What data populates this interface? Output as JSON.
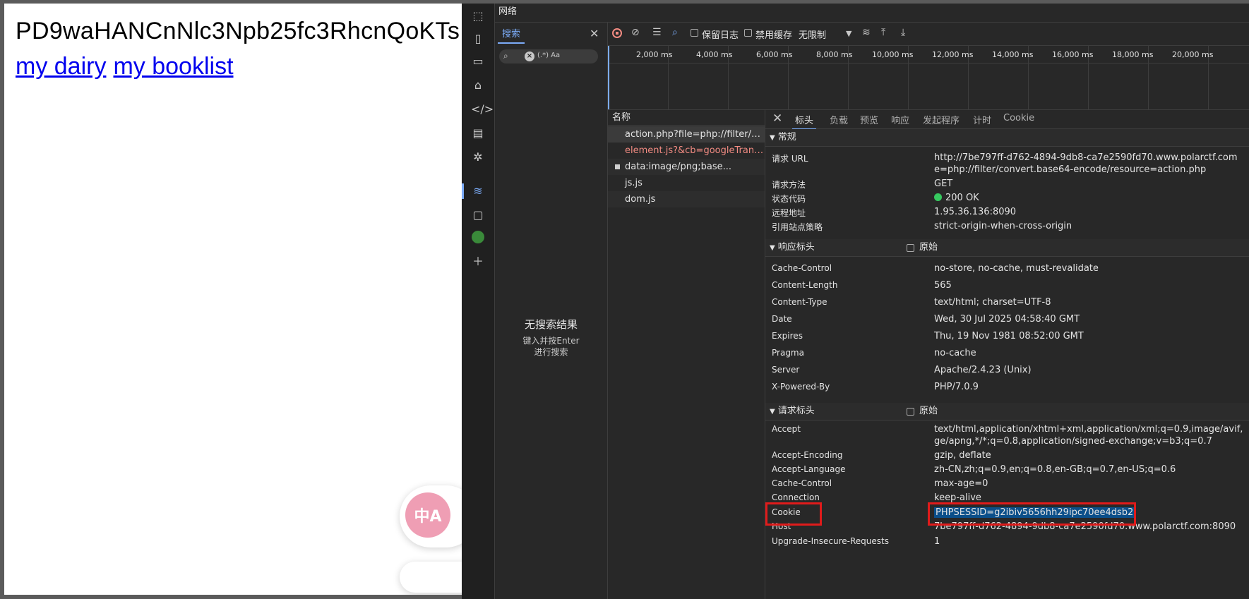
{
  "page": {
    "base64_text": "PD9waHANCnNlc3Npb25fc3RhcnQoKTs",
    "links": [
      "my dairy",
      "my booklist"
    ],
    "translate_glyph": "中A"
  },
  "devtools": {
    "panel_title": "网络",
    "search": {
      "tab_label": "搜索",
      "options_label": "(.*) Aa",
      "no_result_title": "无搜索结果",
      "no_result_hint_1": "键入并按Enter",
      "no_result_hint_2": "进行搜索"
    },
    "toolbar": {
      "preserve_log": "保留日志",
      "disable_cache": "禁用缓存",
      "throttling": "无限制"
    },
    "timeline_ticks": [
      "2,000 ms",
      "4,000 ms",
      "6,000 ms",
      "8,000 ms",
      "10,000 ms",
      "12,000 ms",
      "14,000 ms",
      "16,000 ms",
      "18,000 ms",
      "20,000 ms"
    ],
    "requests": {
      "header": "名称",
      "rows": [
        {
          "name": "action.php?file=php://filter/con..."
        },
        {
          "name": "element.js?&cb=googleTranslat..."
        },
        {
          "name": "data:image/png;base..."
        },
        {
          "name": "js.js"
        },
        {
          "name": "dom.js"
        }
      ]
    },
    "detail_tabs": [
      "标头",
      "负载",
      "预览",
      "响应",
      "发起程序",
      "计时",
      "Cookie"
    ],
    "general": {
      "title": "常规",
      "request_url_label": "请求 URL",
      "request_url_line1": "http://7be797ff-d762-4894-9db8-ca7e2590fd70.www.polarctf.com",
      "request_url_line2": "e=php://filter/convert.base64-encode/resource=action.php",
      "method_label": "请求方法",
      "method": "GET",
      "status_label": "状态代码",
      "status": "200 OK",
      "remote_label": "远程地址",
      "remote": "1.95.36.136:8090",
      "referrer_label": "引用站点策略",
      "referrer": "strict-origin-when-cross-origin"
    },
    "response_headers": {
      "title": "响应标头",
      "raw_label": "原始",
      "items": [
        {
          "k": "Cache-Control",
          "v": "no-store, no-cache, must-revalidate"
        },
        {
          "k": "Content-Length",
          "v": "565"
        },
        {
          "k": "Content-Type",
          "v": "text/html; charset=UTF-8"
        },
        {
          "k": "Date",
          "v": "Wed, 30 Jul 2025 04:58:40 GMT"
        },
        {
          "k": "Expires",
          "v": "Thu, 19 Nov 1981 08:52:00 GMT"
        },
        {
          "k": "Pragma",
          "v": "no-cache"
        },
        {
          "k": "Server",
          "v": "Apache/2.4.23 (Unix)"
        },
        {
          "k": "X-Powered-By",
          "v": "PHP/7.0.9"
        }
      ]
    },
    "request_headers": {
      "title": "请求标头",
      "raw_label": "原始",
      "accept_label": "Accept",
      "accept_line1": "text/html,application/xhtml+xml,application/xml;q=0.9,image/avif,",
      "accept_line2": "ge/apng,*/*;q=0.8,application/signed-exchange;v=b3;q=0.7",
      "encoding_label": "Accept-Encoding",
      "encoding": "gzip, deflate",
      "language_label": "Accept-Language",
      "language": "zh-CN,zh;q=0.9,en;q=0.8,en-GB;q=0.7,en-US;q=0.6",
      "cache_label": "Cache-Control",
      "cache": "max-age=0",
      "connection_label": "Connection",
      "connection": "keep-alive",
      "cookie_label": "Cookie",
      "cookie": "PHPSESSID=g2ibiv5656hh29ipc70ee4dsb2",
      "host_label": "Host",
      "host": "7be797ff-d762-4894-9db8-ca7e2590fd70.www.polarctf.com:8090",
      "upgrade_label": "Upgrade-Insecure-Requests",
      "upgrade": "1"
    }
  }
}
